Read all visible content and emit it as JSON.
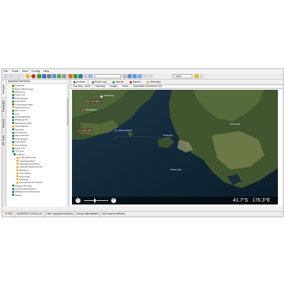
{
  "menu": [
    "File",
    "Tools",
    "View",
    "Config",
    "Help"
  ],
  "toolbar": {
    "period_value": "1 week",
    "colors": {
      "yellow": "#e2b93b",
      "red": "#c8322e",
      "green": "#3a9a3f",
      "blue": "#3a6fc0"
    }
  },
  "vtabs": [
    "Navigate",
    "Favourites",
    "Reports",
    "Alt. Tools"
  ],
  "tree": {
    "header": "AquariusTimeSeries",
    "items": [
      "Kaiwaiwai",
      "Barron/Whitenhead",
      "Mangaone",
      "Upper Grd",
      "Ruamahanga",
      "Porirua/Fal",
      "Cambridge/CUSW",
      "Waikanae/Conn",
      "Plimmerton",
      "Hutt",
      "Otaki/Otaki/ESS",
      "Waikanae/TC",
      "Pauatahanui/Glen",
      "Ohau/Waitohu",
      "Waiwhetu",
      "Pauatahanui",
      "Tasman/Pointe",
      "Ruamahanga",
      "Porirua/Nov",
      "Glen/Whiting",
      "Hutt/ColUt",
      "TPN Tele",
      "ColdFlux",
      "Lowland/Ntorelidy",
      "Lakewakea/Glen",
      "Lalanga/stonal/Waron",
      "Lallaypon/Stolal/Kaimha",
      "Waitanga",
      "Laurenbaker",
      "Stormwater",
      "Waitanga",
      "Pauatahani/TPN (South)",
      "Wallace/TPN Tele",
      "Aquarius/FilerChannel",
      "Waiwhetu/Cross/Sunshine",
      "Taitoka"
    ]
  },
  "tabs_main": [
    {
      "label": "Analysis",
      "active": true
    },
    {
      "label": "Event Log",
      "active": false
    },
    {
      "label": "Journal",
      "active": false
    },
    {
      "label": "Alarms",
      "active": false
    },
    {
      "label": "Telemetry",
      "active": false
    }
  ],
  "tabs_sub": [
    {
      "label": "Map Bing - Aerial",
      "active": true
    },
    {
      "label": "Summary",
      "active": false
    },
    {
      "label": "Images",
      "active": false
    },
    {
      "label": "Notes",
      "active": false
    },
    {
      "label": "Information (Catchment 1/2)",
      "active": false
    }
  ],
  "map": {
    "pins": [
      {
        "label": "Akatarawa",
        "color": "#ffffff"
      },
      {
        "label": "Hutt Valley",
        "color": "#e23b3b"
      },
      {
        "label": "Paekakariki",
        "color": "#e23b3b"
      },
      {
        "label": "Karori Hill",
        "color": "#e23b3b"
      },
      {
        "label": "Hutt/Lowerhutt",
        "color": "#3b6ee2"
      }
    ],
    "place_labels": [
      "Wellington",
      "Palliser Bay",
      "Wairarapa"
    ],
    "zoom_in": "+",
    "zoom_out": "−",
    "lat": "41.7°S",
    "lon": "176.3°E"
  },
  "status": {
    "code": "DNC",
    "datetime": "10/06/2020 9:03:53 a.m.",
    "user": "User: HyQuest Solutions",
    "group": "Group: Administrator",
    "records": "100 records retrieved"
  }
}
